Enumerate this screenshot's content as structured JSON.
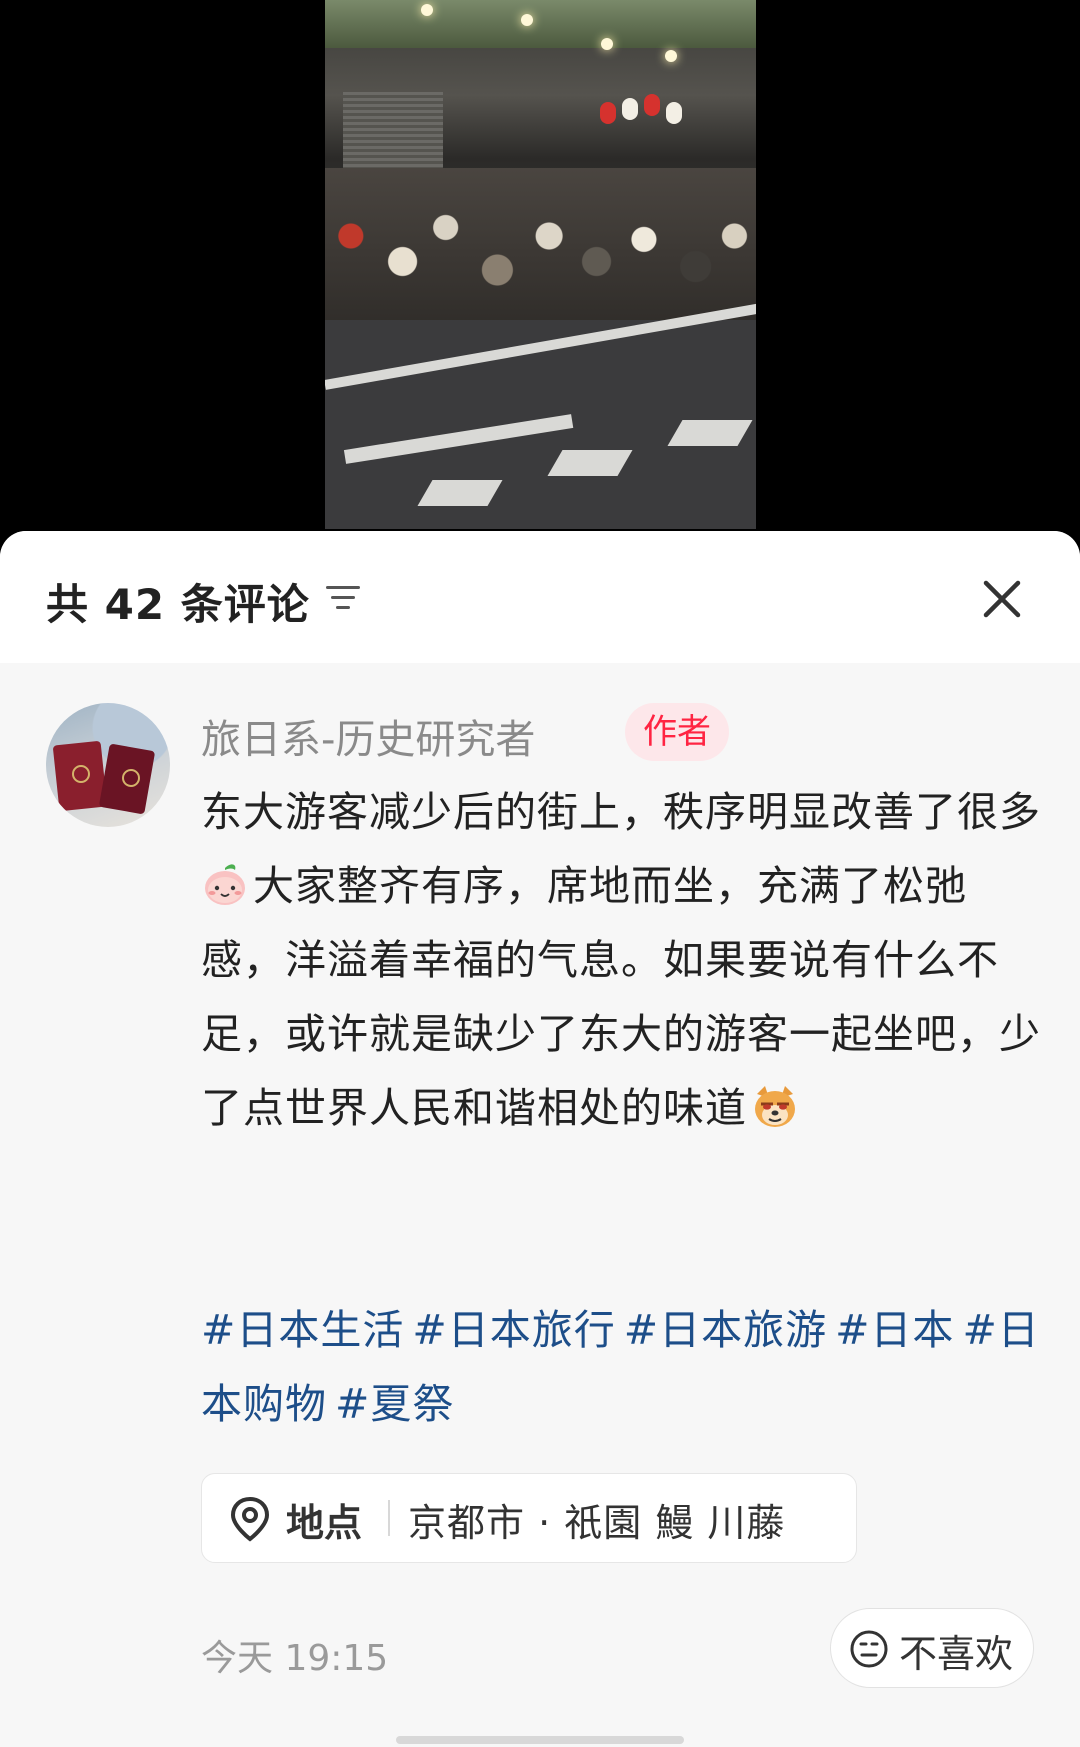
{
  "video": {
    "description_icon": "street-crowd-photo"
  },
  "header": {
    "title": "共 42 条评论",
    "sort_icon": "sort-lines-icon",
    "close_icon": "close-icon"
  },
  "comment": {
    "username": "旅日系-历史研究者",
    "author_badge": "作者",
    "paragraph1": "东大游客减少后的街上，秩序明显改善了很多",
    "paragraph2": "大家整齐有序，席地而坐，充满了松弛感，洋溢着幸福的气息。如果要说有什么不足，或许就是缺少了东大的游客一起坐吧，少了点世界人民和谐相处的味道",
    "emoji1": "peach-face-emoji",
    "emoji2": "smug-dog-emoji",
    "tags": [
      "#日本生活",
      "#日本旅行",
      "#日本旅游",
      "#日本",
      "#日本购物",
      "#夏祭"
    ],
    "location": {
      "label": "地点",
      "value": "京都市 · 祇園 鰻 川藤",
      "icon": "location-pin-icon"
    },
    "timestamp": "今天 19:15",
    "dislike_label": "不喜欢",
    "dislike_icon": "neutral-face-icon"
  },
  "colors": {
    "badge_text": "#ff2442",
    "badge_bg": "#fde7ea",
    "tag_color": "#1d4e89"
  }
}
